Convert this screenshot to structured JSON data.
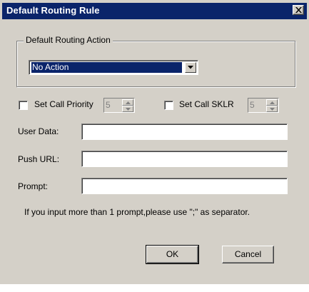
{
  "window": {
    "title": "Default Routing Rule"
  },
  "routing_action": {
    "group_label": "Default Routing Action",
    "selected": "No Action"
  },
  "call_priority": {
    "label": "Set Call Priority",
    "checked": false,
    "value": "5"
  },
  "call_sklr": {
    "label": "Set Call SKLR",
    "checked": false,
    "value": "5"
  },
  "fields": {
    "user_data_label": "User Data:",
    "user_data_value": "",
    "push_url_label": "Push URL:",
    "push_url_value": "",
    "prompt_label": "Prompt:",
    "prompt_value": ""
  },
  "hint": "If you input more than 1 prompt,please use \";\" as separator.",
  "buttons": {
    "ok_label": "OK",
    "cancel_label": "Cancel"
  },
  "colors": {
    "titlebar": "#0a246a",
    "dialog_face": "#d4d0c8",
    "selection": "#0a246a"
  }
}
